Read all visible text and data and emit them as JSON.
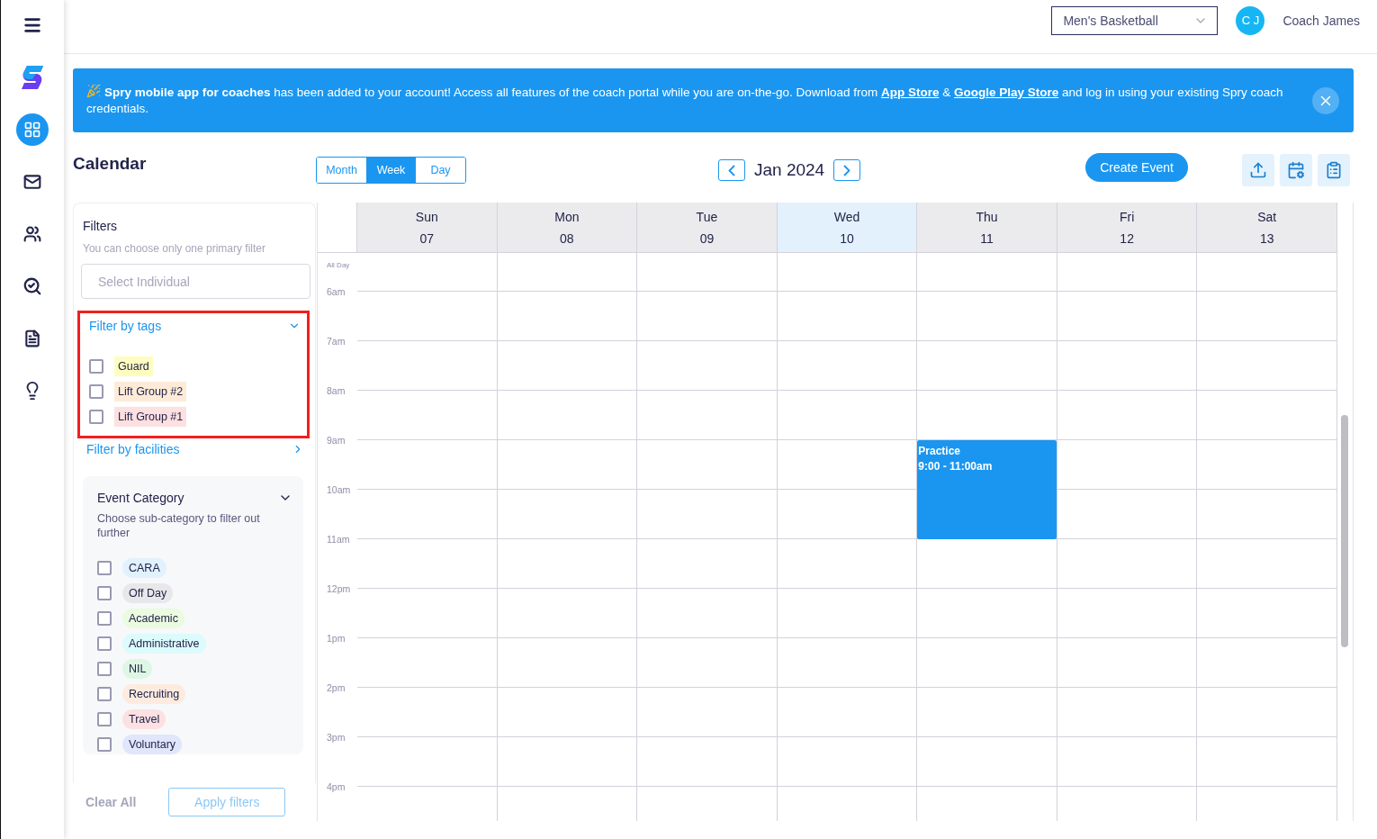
{
  "top_bar": {
    "team_select": {
      "value": "Men's Basketball"
    },
    "avatar": {
      "initials": "C J"
    },
    "user_name": "Coach James"
  },
  "sidebar": {
    "items": [
      {
        "kind": "menu",
        "selected": false
      },
      {
        "kind": "logo",
        "selected": false
      },
      {
        "kind": "dashboard",
        "selected": true
      },
      {
        "kind": "mail",
        "selected": false
      },
      {
        "kind": "team",
        "selected": false
      },
      {
        "kind": "search-person",
        "selected": false
      },
      {
        "kind": "document",
        "selected": false
      },
      {
        "kind": "idea",
        "selected": false
      }
    ]
  },
  "banner": {
    "segments": [
      {
        "kind": "text",
        "text": "**Spry mobile app for coaches** has been added to your account! Access all features of the coach portal while you are on-the-go. Download from "
      },
      {
        "kind": "link",
        "text": "App Store"
      },
      {
        "kind": "text",
        "text": " & "
      },
      {
        "kind": "link",
        "text": "Google Play Store"
      },
      {
        "kind": "text",
        "text": " and log in using your existing Spry coach credentials."
      }
    ]
  },
  "page_title": "Calendar",
  "view_tabs": [
    {
      "label": "Month",
      "selected": false
    },
    {
      "label": "Week",
      "selected": true
    },
    {
      "label": "Day",
      "selected": false
    }
  ],
  "period": "Jan 2024",
  "create_button": "Create Event",
  "filters": {
    "title": "Filters",
    "hint": "You can choose only one primary filter",
    "individual": {
      "placeholder": "Select Individual"
    },
    "tags": {
      "title": "Filter by tags",
      "expanded": true,
      "highlighted": true,
      "items": [
        {
          "label": "Guard",
          "checked": false,
          "color": "#fdfdc0"
        },
        {
          "label": "Lift Group #2",
          "checked": false,
          "color": "#fdebd8"
        },
        {
          "label": "Lift Group #1",
          "checked": false,
          "color": "#fde0e0"
        }
      ]
    },
    "facilities": {
      "title": "Filter by facilities",
      "expanded": false
    },
    "event_category": {
      "title": "Event Category",
      "hint": "Choose sub-category to filter out further",
      "expanded": true,
      "items": [
        {
          "label": "CARA",
          "checked": false,
          "color": "#e1f1fd"
        },
        {
          "label": "Off Day",
          "checked": false,
          "color": "#e8e8ea"
        },
        {
          "label": "Academic",
          "checked": false,
          "color": "#eafbe0"
        },
        {
          "label": "Administrative",
          "checked": false,
          "color": "#dcfbfd"
        },
        {
          "label": "NIL",
          "checked": false,
          "color": "#def7e4"
        },
        {
          "label": "Recruiting",
          "checked": false,
          "color": "#fdebe0"
        },
        {
          "label": "Travel",
          "checked": false,
          "color": "#fde0e2"
        },
        {
          "label": "Voluntary",
          "checked": false,
          "color": "#e0e6fb"
        }
      ]
    },
    "clear_button": "Clear All",
    "apply_button": "Apply filters"
  },
  "calendar": {
    "all_day_label": "All Day",
    "hours": [
      "6am",
      "7am",
      "8am",
      "9am",
      "10am",
      "11am",
      "12pm",
      "1pm",
      "2pm",
      "3pm",
      "4pm"
    ],
    "days": [
      {
        "name": "Sun",
        "date": "07",
        "today": false
      },
      {
        "name": "Mon",
        "date": "08",
        "today": false
      },
      {
        "name": "Tue",
        "date": "09",
        "today": false
      },
      {
        "name": "Wed",
        "date": "10",
        "today": true
      },
      {
        "name": "Thu",
        "date": "11",
        "today": false,
        "events": [
          {
            "title": "Practice",
            "time": "9:00 - 11:00am"
          }
        ]
      },
      {
        "name": "Fri",
        "date": "12",
        "today": false
      },
      {
        "name": "Sat",
        "date": "13",
        "today": false
      }
    ]
  }
}
